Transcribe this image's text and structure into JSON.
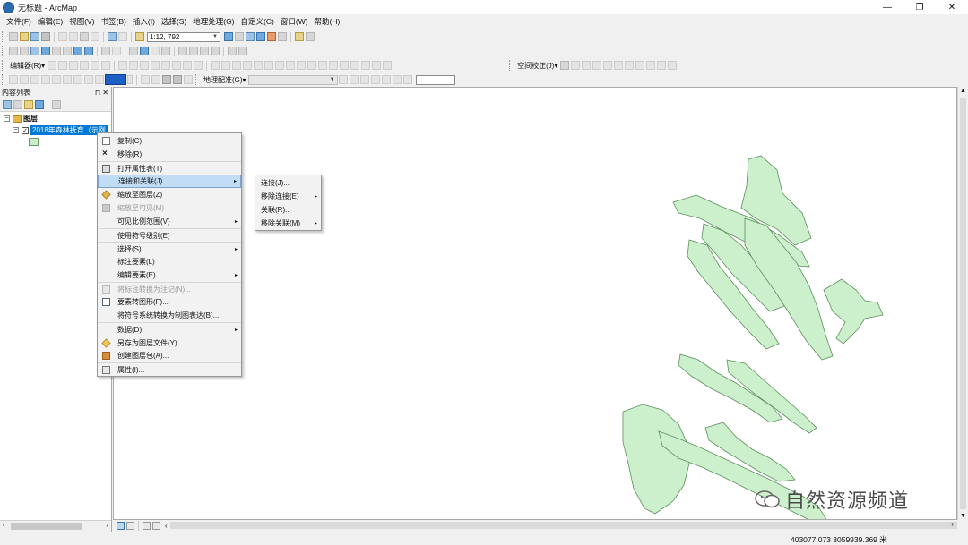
{
  "window": {
    "title": "无标题 - ArcMap",
    "controls": {
      "minimize": "—",
      "restore": "❐",
      "close": "✕"
    }
  },
  "menubar": [
    "文件(F)",
    "编辑(E)",
    "视图(V)",
    "书签(B)",
    "插入(I)",
    "选择(S)",
    "地理处理(G)",
    "自定义(C)",
    "窗口(W)",
    "帮助(H)"
  ],
  "toolbar": {
    "scale": "1:12, 792",
    "editor_label": "编辑器(R)▾",
    "georef_label": "地理配准(G)▾",
    "spatial_adjust_label": "空间校正(J)▾",
    "highlight_color": "#1c5fc7"
  },
  "toc": {
    "title": "内容列表",
    "pin": "⊓ ✕",
    "group_label": "图层",
    "layer_label": "2018年森林抚育（示例",
    "layer_checked": "✓",
    "legend_fill": "#ccf0cc"
  },
  "context_menu": {
    "items": [
      {
        "label": "复制(C)",
        "icon": "copy-icon"
      },
      {
        "label": "移除(R)",
        "icon": "remove-icon"
      },
      {
        "label": "打开属性表(T)",
        "icon": "table-icon"
      },
      {
        "label": "连接和关联(J)",
        "icon": "",
        "submenu": "▸",
        "highlighted": true
      },
      {
        "label": "缩放至图层(Z)",
        "icon": "zoom-to-layer-icon"
      },
      {
        "label": "缩放至可见(M)",
        "icon": "zoom-to-visible-icon",
        "disabled": true
      },
      {
        "label": "可见比例范围(V)",
        "icon": "",
        "submenu": "▸"
      },
      {
        "label": "使用符号级别(E)",
        "icon": ""
      },
      {
        "label": "选择(S)",
        "icon": "",
        "submenu": "▸"
      },
      {
        "label": "标注要素(L)",
        "icon": ""
      },
      {
        "label": "编辑要素(E)",
        "icon": "",
        "submenu": "▸"
      },
      {
        "label": "将标注转换为注记(N)...",
        "icon": "convert-label-icon",
        "disabled": true
      },
      {
        "label": "要素转图形(F)...",
        "icon": "graphics-icon"
      },
      {
        "label": "将符号系统转换为制图表达(B)...",
        "icon": ""
      },
      {
        "label": "数据(D)",
        "icon": "",
        "submenu": "▸"
      },
      {
        "label": "另存为图层文件(Y)...",
        "icon": "save-layer-icon"
      },
      {
        "label": "创建图层包(A)...",
        "icon": "layer-package-icon"
      },
      {
        "label": "属性(I)...",
        "icon": "properties-icon"
      }
    ],
    "submenu": [
      {
        "label": "连接(J)...",
        "arrow": ""
      },
      {
        "label": "移除连接(E)",
        "arrow": "▸"
      },
      {
        "label": "关联(R)...",
        "arrow": ""
      },
      {
        "label": "移除关联(M)",
        "arrow": "▸"
      }
    ]
  },
  "map": {
    "polygon_fill": "#ccf0cc",
    "polygon_stroke": "#5d8f5d"
  },
  "statusbar": {
    "coords": "403077.073  3059939.369 米"
  },
  "watermark": {
    "text": "自然资源频道"
  }
}
